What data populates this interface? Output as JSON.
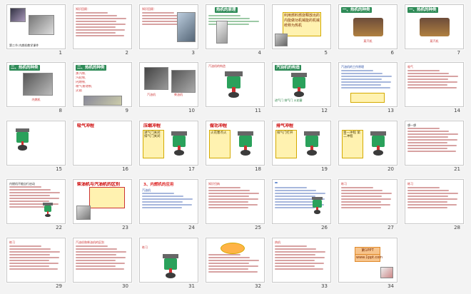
{
  "window": {
    "title": "Slide Sorter"
  },
  "slides": [
    {
      "num": "1",
      "title": "",
      "texts": [
        "第二节 内燃机教学课件"
      ]
    },
    {
      "num": "2",
      "title": "",
      "texts": [
        "知识回顾：",
        "温度、内能的关系"
      ]
    },
    {
      "num": "3",
      "title": "",
      "texts": [
        "知识回顾：",
        "热机的原理"
      ]
    },
    {
      "num": "4",
      "title": "热机的原理",
      "texts": [
        "燃料燃烧",
        "化学能→内能→机械能"
      ]
    },
    {
      "num": "5",
      "title": "",
      "texts": [
        "利用燃料燃烧",
        "释放出的内能做功",
        "机械能的机械",
        "统称为热机"
      ]
    },
    {
      "num": "6",
      "title": "一、热机的种类",
      "texts": [
        "蒸汽机"
      ]
    },
    {
      "num": "7",
      "title": "一、热机的种类",
      "texts": [
        "蒸汽机"
      ]
    },
    {
      "num": "8",
      "title": "二、热机的种类",
      "texts": [
        "内燃机"
      ]
    },
    {
      "num": "9",
      "title": "二、热机的种类",
      "texts": [
        "蒸汽机",
        "汽轮机",
        "内燃机",
        "喷气发动机",
        "火箭"
      ]
    },
    {
      "num": "10",
      "title": "",
      "texts": [
        "汽油机",
        "柴油机"
      ]
    },
    {
      "num": "11",
      "title": "",
      "texts": [
        "汽油机的构造"
      ]
    },
    {
      "num": "12",
      "title": "",
      "texts": [
        "汽油机的构造",
        "进气门 排气门 火花塞"
      ]
    },
    {
      "num": "13",
      "title": "",
      "texts": [
        "汽油机的工作原理"
      ]
    },
    {
      "num": "14",
      "title": "",
      "texts": [
        "吸气",
        "压缩",
        "做功",
        "排气"
      ]
    },
    {
      "num": "15",
      "title": "汽油机工作原理",
      "texts": []
    },
    {
      "num": "16",
      "title": "吸气冲程",
      "texts": [
        "进气门打开",
        "排气门关闭"
      ]
    },
    {
      "num": "17",
      "title": "压缩冲程",
      "texts": [
        "进气门关闭",
        "排气门关闭"
      ]
    },
    {
      "num": "18",
      "title": "做功冲程",
      "texts": [
        "火花塞点火"
      ]
    },
    {
      "num": "19",
      "title": "排气冲程",
      "texts": [
        "排气门打开"
      ]
    },
    {
      "num": "20",
      "title": "",
      "texts": [
        "第一冲程",
        "第二冲程",
        "第三冲程",
        "第四冲程"
      ]
    },
    {
      "num": "21",
      "title": "",
      "texts": [
        "想一想"
      ]
    },
    {
      "num": "22",
      "title": "2、内燃机的启动",
      "texts": [
        "内燃机不能自行启动"
      ]
    },
    {
      "num": "23",
      "title": "",
      "texts": [
        "柴油机与汽油机的区别"
      ]
    },
    {
      "num": "24",
      "title": "3、内燃机的应用",
      "texts": [
        "汽油机",
        "柴油机"
      ]
    },
    {
      "num": "25",
      "title": "",
      "texts": [
        "知识归纳"
      ]
    },
    {
      "num": "26",
      "title": "",
      "texts": [
        "练习"
      ]
    },
    {
      "num": "27",
      "title": "",
      "texts": [
        "练习"
      ]
    },
    {
      "num": "28",
      "title": "",
      "texts": [
        "练习"
      ]
    },
    {
      "num": "29",
      "title": "",
      "texts": [
        "练习"
      ]
    },
    {
      "num": "30",
      "title": "想想议议",
      "texts": [
        "汽油机和柴油机的区别"
      ]
    },
    {
      "num": "31",
      "title": "",
      "texts": [
        "练习"
      ]
    },
    {
      "num": "32",
      "title": "",
      "texts": [
        "练习"
      ]
    },
    {
      "num": "33",
      "title": "小结：",
      "texts": [
        "热机",
        "内燃机",
        "汽油机",
        "柴油机"
      ]
    },
    {
      "num": "34",
      "title": "",
      "texts": [
        "第1PPT",
        "www.1ppt.com"
      ]
    }
  ],
  "colors": {
    "accent": "#2e8b57",
    "red": "#d22222",
    "blue": "#2b4fa5",
    "piston": "#2aa15b"
  }
}
